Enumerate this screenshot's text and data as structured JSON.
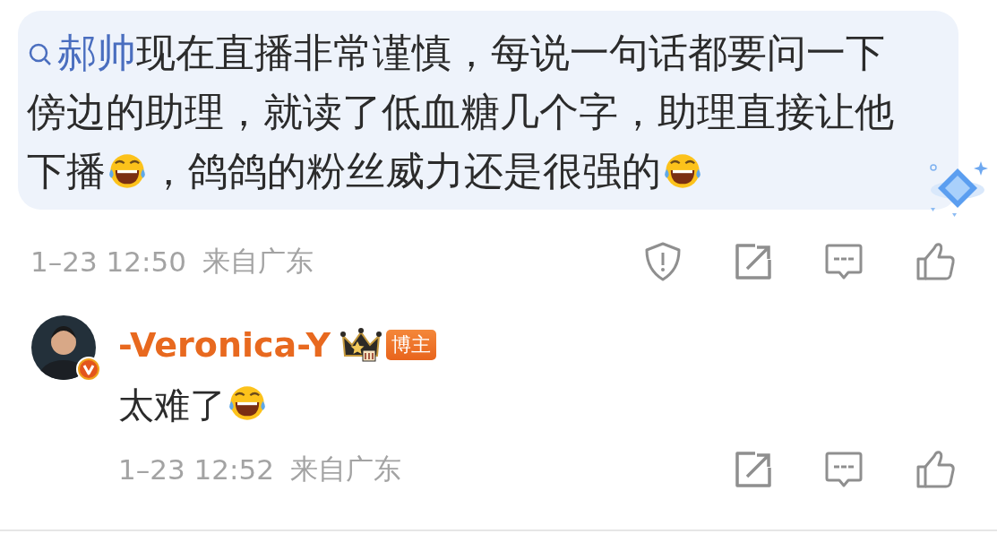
{
  "quote": {
    "segments": [
      {
        "kind": "mention",
        "text": "郝帅"
      },
      {
        "kind": "text",
        "text": "现在直播非常谨慎，每说一句话都要问一下傍边的助理，就读了低血糖几个字，助理直接让他下播"
      },
      {
        "kind": "emoji"
      },
      {
        "kind": "text",
        "text": "，鸽鸽的粉丝威力还是很强的"
      },
      {
        "kind": "emoji"
      }
    ]
  },
  "post_meta": {
    "time": "1–23 12:50",
    "location": "来自广东",
    "actions": [
      {
        "kind": "report"
      },
      {
        "kind": "share"
      },
      {
        "kind": "comment"
      },
      {
        "kind": "like"
      }
    ]
  },
  "reply": {
    "author": "-Veronica-Y",
    "badge": "博主",
    "verified": true,
    "segments": [
      {
        "kind": "text",
        "text": "太难了"
      },
      {
        "kind": "emoji"
      }
    ],
    "meta": {
      "time": "1–23 12:52",
      "location": "来自广东",
      "actions": [
        {
          "kind": "share"
        },
        {
          "kind": "comment"
        },
        {
          "kind": "like"
        }
      ]
    }
  }
}
